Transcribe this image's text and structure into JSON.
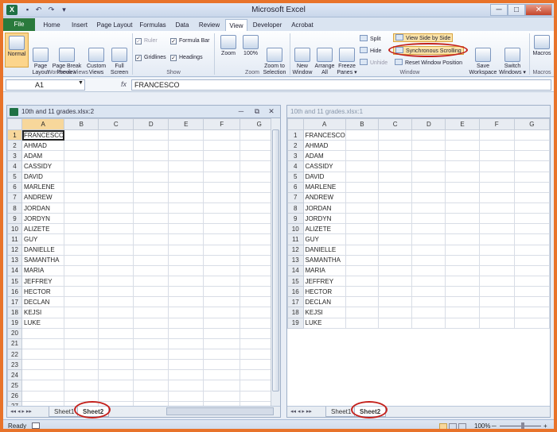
{
  "titlebar": {
    "title": "Microsoft Excel",
    "app_icon": "X",
    "minimize": "─",
    "maximize": "□",
    "close": "✕"
  },
  "tabs": [
    "File",
    "Home",
    "Insert",
    "Page Layout",
    "Formulas",
    "Data",
    "Review",
    "View",
    "Developer",
    "Acrobat"
  ],
  "ribbon": {
    "normal": "Normal",
    "page_layout": "Page\nLayout",
    "page_break": "Page Break\nPreview",
    "custom_views": "Custom\nViews",
    "full_screen": "Full\nScreen",
    "ruler": "Ruler",
    "gridlines": "Gridlines",
    "formula_bar": "Formula Bar",
    "headings": "Headings",
    "zoom": "Zoom",
    "zoom100": "100%",
    "zoom_sel": "Zoom to\nSelection",
    "new_window": "New\nWindow",
    "arrange_all": "Arrange\nAll",
    "freeze": "Freeze\nPanes ▾",
    "split": "Split",
    "hide": "Hide",
    "unhide": "Unhide",
    "view_side": "View Side by Side",
    "sync_scroll": "Synchronous Scrolling",
    "reset_pos": "Reset Window Position",
    "save_ws": "Save\nWorkspace",
    "switch_win": "Switch\nWindows ▾",
    "macros": "Macros",
    "groups": {
      "workbook_views": "Workbook Views",
      "show": "Show",
      "zoom": "Zoom",
      "window": "Window",
      "macros": "Macros"
    }
  },
  "formula_bar": {
    "name_box": "A1",
    "fx": "fx",
    "value": "FRANCESCO"
  },
  "columns_left": [
    "A",
    "B",
    "C",
    "D",
    "E",
    "F",
    "G"
  ],
  "columns_right": [
    "A",
    "B",
    "C",
    "D",
    "E",
    "F",
    "G"
  ],
  "names": [
    "FRANCESCO",
    "AHMAD",
    "ADAM",
    "CASSIDY",
    "DAVID",
    "MARLENE",
    "ANDREW",
    "JORDAN",
    "JORDYN",
    "ALIZETE",
    "GUY",
    "DANIELLE",
    "SAMANTHA",
    "MARIA",
    "JEFFREY",
    "HECTOR",
    "DECLAN",
    "KEJSI",
    "LUKE"
  ],
  "left_window": {
    "title": "10th and 11 grades.xlsx:2",
    "minimize": "─",
    "restore": "⧉",
    "close": "✕",
    "sheets": [
      "Sheet1",
      "Sheet2"
    ]
  },
  "right_window": {
    "title": "10th and 11 grades.xlsx:1",
    "sheets": [
      "Sheet1",
      "Sheet2"
    ]
  },
  "status": {
    "ready": "Ready",
    "zoom": "100%",
    "minus": "─",
    "plus": "+"
  }
}
